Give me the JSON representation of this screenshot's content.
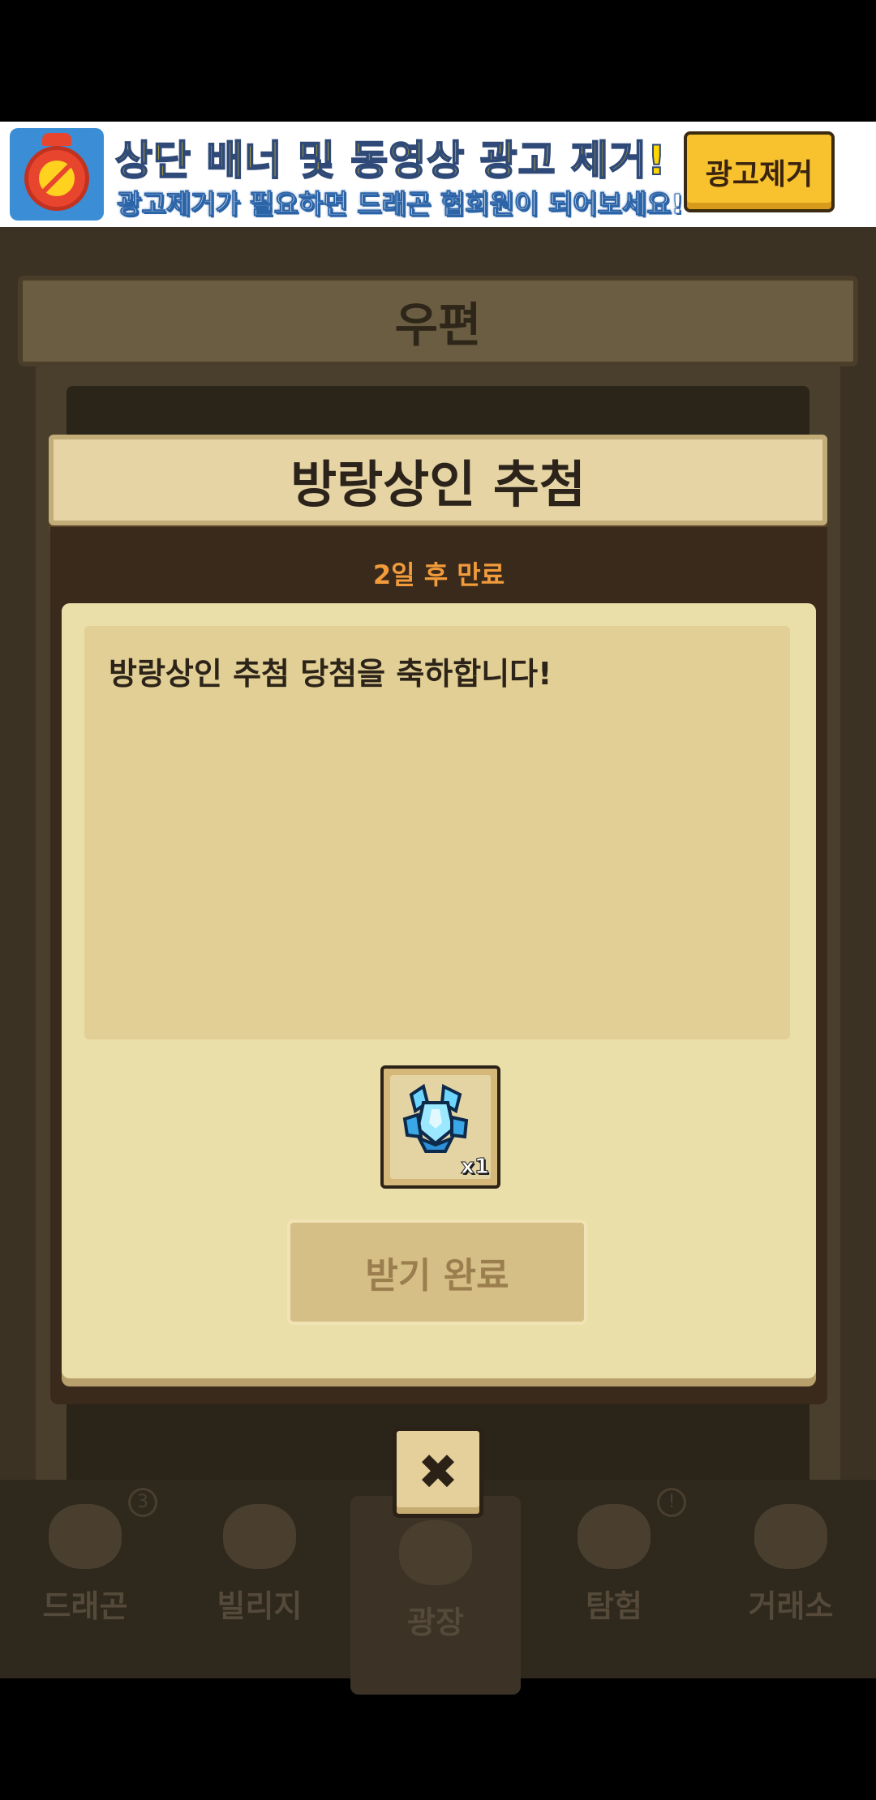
{
  "ad_banner": {
    "title": "상단 배너 및 동영상 광고 제거!",
    "subtitle": "광고제거가 필요하면 드래곤 협회원이 되어보세요!",
    "remove_button_label": "광고제거",
    "icon": "ad-block-clock-icon"
  },
  "mail": {
    "header_title": "우편"
  },
  "popup": {
    "title": "방랑상인 추첨",
    "expiry": "2일 후 만료",
    "message": "방랑상인 추첨 당첨을 축하합니다!",
    "reward": {
      "icon": "blue-crystal-icon",
      "quantity": "x1"
    },
    "claimed_button_label": "받기 완료",
    "close_icon": "close-icon"
  },
  "bottom_nav": {
    "tabs": [
      {
        "label": "드래곤",
        "icon": "dragon-icon",
        "badge": "3"
      },
      {
        "label": "빌리지",
        "icon": "village-icon",
        "badge": ""
      },
      {
        "label": "광장",
        "icon": "plaza-icon",
        "badge": ""
      },
      {
        "label": "탐험",
        "icon": "compass-icon",
        "badge": "!"
      },
      {
        "label": "거래소",
        "icon": "exchange-icon",
        "badge": ""
      }
    ]
  },
  "colors": {
    "ad_title": "#ffd600",
    "expiry_text": "#f19b3a",
    "paper": "#ebdfa9",
    "button_disabled": "#d6bf87"
  }
}
